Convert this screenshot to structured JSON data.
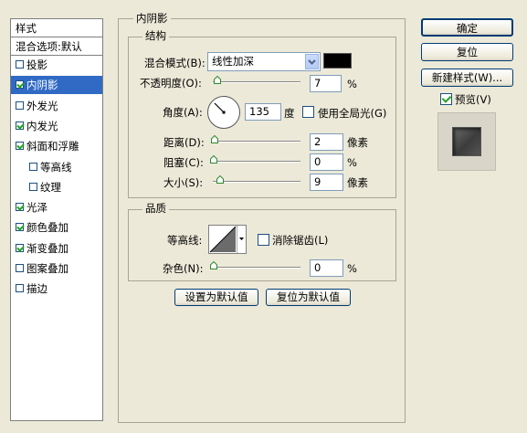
{
  "sidebar": {
    "header": "样式",
    "blend_options": "混合选项:默认",
    "items": [
      {
        "label": "投影",
        "checked": false,
        "selected": false
      },
      {
        "label": "内阴影",
        "checked": true,
        "selected": true
      },
      {
        "label": "外发光",
        "checked": false,
        "selected": false
      },
      {
        "label": "内发光",
        "checked": true,
        "selected": false
      },
      {
        "label": "斜面和浮雕",
        "checked": true,
        "selected": false
      },
      {
        "label": "等高线",
        "checked": false,
        "selected": false
      },
      {
        "label": "纹理",
        "checked": false,
        "selected": false
      },
      {
        "label": "光泽",
        "checked": true,
        "selected": false
      },
      {
        "label": "颜色叠加",
        "checked": true,
        "selected": false
      },
      {
        "label": "渐变叠加",
        "checked": true,
        "selected": false
      },
      {
        "label": "图案叠加",
        "checked": false,
        "selected": false
      },
      {
        "label": "描边",
        "checked": false,
        "selected": false
      }
    ]
  },
  "panel": {
    "title": "内阴影",
    "structure": {
      "title": "结构",
      "blend_mode_label": "混合模式(B):",
      "blend_mode_value": "线性加深",
      "blend_color": "#000000",
      "opacity_label": "不透明度(O):",
      "opacity_value": "7",
      "opacity_unit": "%",
      "angle_label": "角度(A):",
      "angle_value": "135",
      "angle_unit": "度",
      "global_light_label": "使用全局光(G)",
      "global_light_checked": false,
      "distance_label": "距离(D):",
      "distance_value": "2",
      "distance_unit": "像素",
      "choke_label": "阻塞(C):",
      "choke_value": "0",
      "choke_unit": "%",
      "size_label": "大小(S):",
      "size_value": "9",
      "size_unit": "像素"
    },
    "quality": {
      "title": "品质",
      "contour_label": "等高线:",
      "antialias_label": "消除锯齿(L)",
      "antialias_checked": false,
      "noise_label": "杂色(N):",
      "noise_value": "0",
      "noise_unit": "%"
    },
    "make_default": "设置为默认值",
    "reset_default": "复位为默认值"
  },
  "buttons": {
    "ok": "确定",
    "reset": "复位",
    "new_style": "新建样式(W)...",
    "preview_label": "预览(V)",
    "preview_checked": true
  }
}
